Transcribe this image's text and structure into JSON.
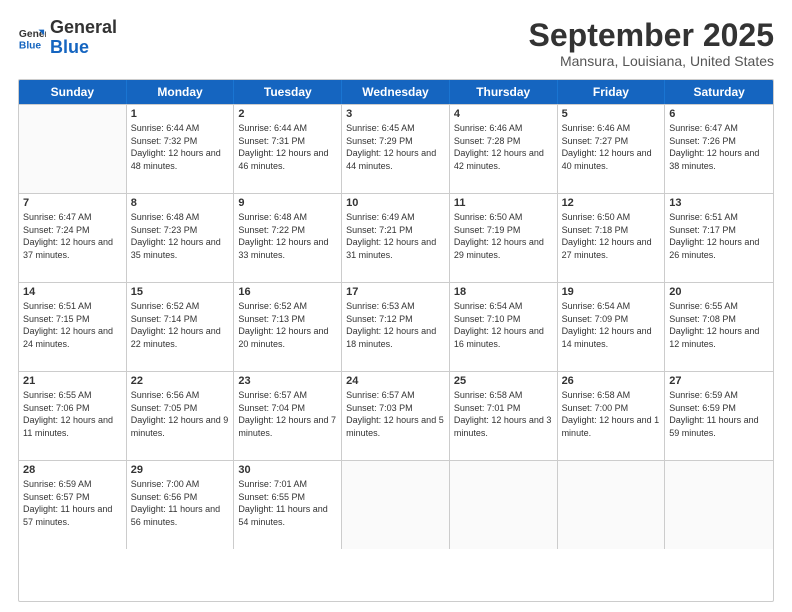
{
  "header": {
    "logo_general": "General",
    "logo_blue": "Blue",
    "month_title": "September 2025",
    "location": "Mansura, Louisiana, United States"
  },
  "weekdays": [
    "Sunday",
    "Monday",
    "Tuesday",
    "Wednesday",
    "Thursday",
    "Friday",
    "Saturday"
  ],
  "rows": [
    [
      {
        "day": "",
        "sunrise": "",
        "sunset": "",
        "daylight": ""
      },
      {
        "day": "1",
        "sunrise": "6:44 AM",
        "sunset": "7:32 PM",
        "daylight": "12 hours and 48 minutes."
      },
      {
        "day": "2",
        "sunrise": "6:44 AM",
        "sunset": "7:31 PM",
        "daylight": "12 hours and 46 minutes."
      },
      {
        "day": "3",
        "sunrise": "6:45 AM",
        "sunset": "7:29 PM",
        "daylight": "12 hours and 44 minutes."
      },
      {
        "day": "4",
        "sunrise": "6:46 AM",
        "sunset": "7:28 PM",
        "daylight": "12 hours and 42 minutes."
      },
      {
        "day": "5",
        "sunrise": "6:46 AM",
        "sunset": "7:27 PM",
        "daylight": "12 hours and 40 minutes."
      },
      {
        "day": "6",
        "sunrise": "6:47 AM",
        "sunset": "7:26 PM",
        "daylight": "12 hours and 38 minutes."
      }
    ],
    [
      {
        "day": "7",
        "sunrise": "6:47 AM",
        "sunset": "7:24 PM",
        "daylight": "12 hours and 37 minutes."
      },
      {
        "day": "8",
        "sunrise": "6:48 AM",
        "sunset": "7:23 PM",
        "daylight": "12 hours and 35 minutes."
      },
      {
        "day": "9",
        "sunrise": "6:48 AM",
        "sunset": "7:22 PM",
        "daylight": "12 hours and 33 minutes."
      },
      {
        "day": "10",
        "sunrise": "6:49 AM",
        "sunset": "7:21 PM",
        "daylight": "12 hours and 31 minutes."
      },
      {
        "day": "11",
        "sunrise": "6:50 AM",
        "sunset": "7:19 PM",
        "daylight": "12 hours and 29 minutes."
      },
      {
        "day": "12",
        "sunrise": "6:50 AM",
        "sunset": "7:18 PM",
        "daylight": "12 hours and 27 minutes."
      },
      {
        "day": "13",
        "sunrise": "6:51 AM",
        "sunset": "7:17 PM",
        "daylight": "12 hours and 26 minutes."
      }
    ],
    [
      {
        "day": "14",
        "sunrise": "6:51 AM",
        "sunset": "7:15 PM",
        "daylight": "12 hours and 24 minutes."
      },
      {
        "day": "15",
        "sunrise": "6:52 AM",
        "sunset": "7:14 PM",
        "daylight": "12 hours and 22 minutes."
      },
      {
        "day": "16",
        "sunrise": "6:52 AM",
        "sunset": "7:13 PM",
        "daylight": "12 hours and 20 minutes."
      },
      {
        "day": "17",
        "sunrise": "6:53 AM",
        "sunset": "7:12 PM",
        "daylight": "12 hours and 18 minutes."
      },
      {
        "day": "18",
        "sunrise": "6:54 AM",
        "sunset": "7:10 PM",
        "daylight": "12 hours and 16 minutes."
      },
      {
        "day": "19",
        "sunrise": "6:54 AM",
        "sunset": "7:09 PM",
        "daylight": "12 hours and 14 minutes."
      },
      {
        "day": "20",
        "sunrise": "6:55 AM",
        "sunset": "7:08 PM",
        "daylight": "12 hours and 12 minutes."
      }
    ],
    [
      {
        "day": "21",
        "sunrise": "6:55 AM",
        "sunset": "7:06 PM",
        "daylight": "12 hours and 11 minutes."
      },
      {
        "day": "22",
        "sunrise": "6:56 AM",
        "sunset": "7:05 PM",
        "daylight": "12 hours and 9 minutes."
      },
      {
        "day": "23",
        "sunrise": "6:57 AM",
        "sunset": "7:04 PM",
        "daylight": "12 hours and 7 minutes."
      },
      {
        "day": "24",
        "sunrise": "6:57 AM",
        "sunset": "7:03 PM",
        "daylight": "12 hours and 5 minutes."
      },
      {
        "day": "25",
        "sunrise": "6:58 AM",
        "sunset": "7:01 PM",
        "daylight": "12 hours and 3 minutes."
      },
      {
        "day": "26",
        "sunrise": "6:58 AM",
        "sunset": "7:00 PM",
        "daylight": "12 hours and 1 minute."
      },
      {
        "day": "27",
        "sunrise": "6:59 AM",
        "sunset": "6:59 PM",
        "daylight": "11 hours and 59 minutes."
      }
    ],
    [
      {
        "day": "28",
        "sunrise": "6:59 AM",
        "sunset": "6:57 PM",
        "daylight": "11 hours and 57 minutes."
      },
      {
        "day": "29",
        "sunrise": "7:00 AM",
        "sunset": "6:56 PM",
        "daylight": "11 hours and 56 minutes."
      },
      {
        "day": "30",
        "sunrise": "7:01 AM",
        "sunset": "6:55 PM",
        "daylight": "11 hours and 54 minutes."
      },
      {
        "day": "",
        "sunrise": "",
        "sunset": "",
        "daylight": ""
      },
      {
        "day": "",
        "sunrise": "",
        "sunset": "",
        "daylight": ""
      },
      {
        "day": "",
        "sunrise": "",
        "sunset": "",
        "daylight": ""
      },
      {
        "day": "",
        "sunrise": "",
        "sunset": "",
        "daylight": ""
      }
    ]
  ]
}
